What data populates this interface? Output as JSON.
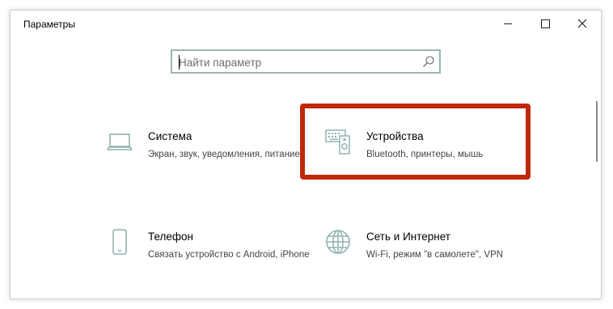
{
  "window": {
    "title": "Параметры"
  },
  "search": {
    "placeholder": "Найти параметр",
    "value": ""
  },
  "tiles": [
    {
      "title": "Система",
      "description": "Экран, звук, уведомления, питание",
      "icon": "laptop-icon"
    },
    {
      "title": "Устройства",
      "description": "Bluetooth, принтеры, мышь",
      "icon": "devices-icon"
    },
    {
      "title": "Телефон",
      "description": "Связать устройство с Android, iPhone",
      "icon": "phone-icon"
    },
    {
      "title": "Сеть и Интернет",
      "description": "Wi-Fi, режим \"в самолете\", VPN",
      "icon": "globe-icon"
    }
  ],
  "colors": {
    "accent_icon": "#8fb3b0",
    "highlight": "#c0280a",
    "search_border": "#9cb5b5"
  }
}
